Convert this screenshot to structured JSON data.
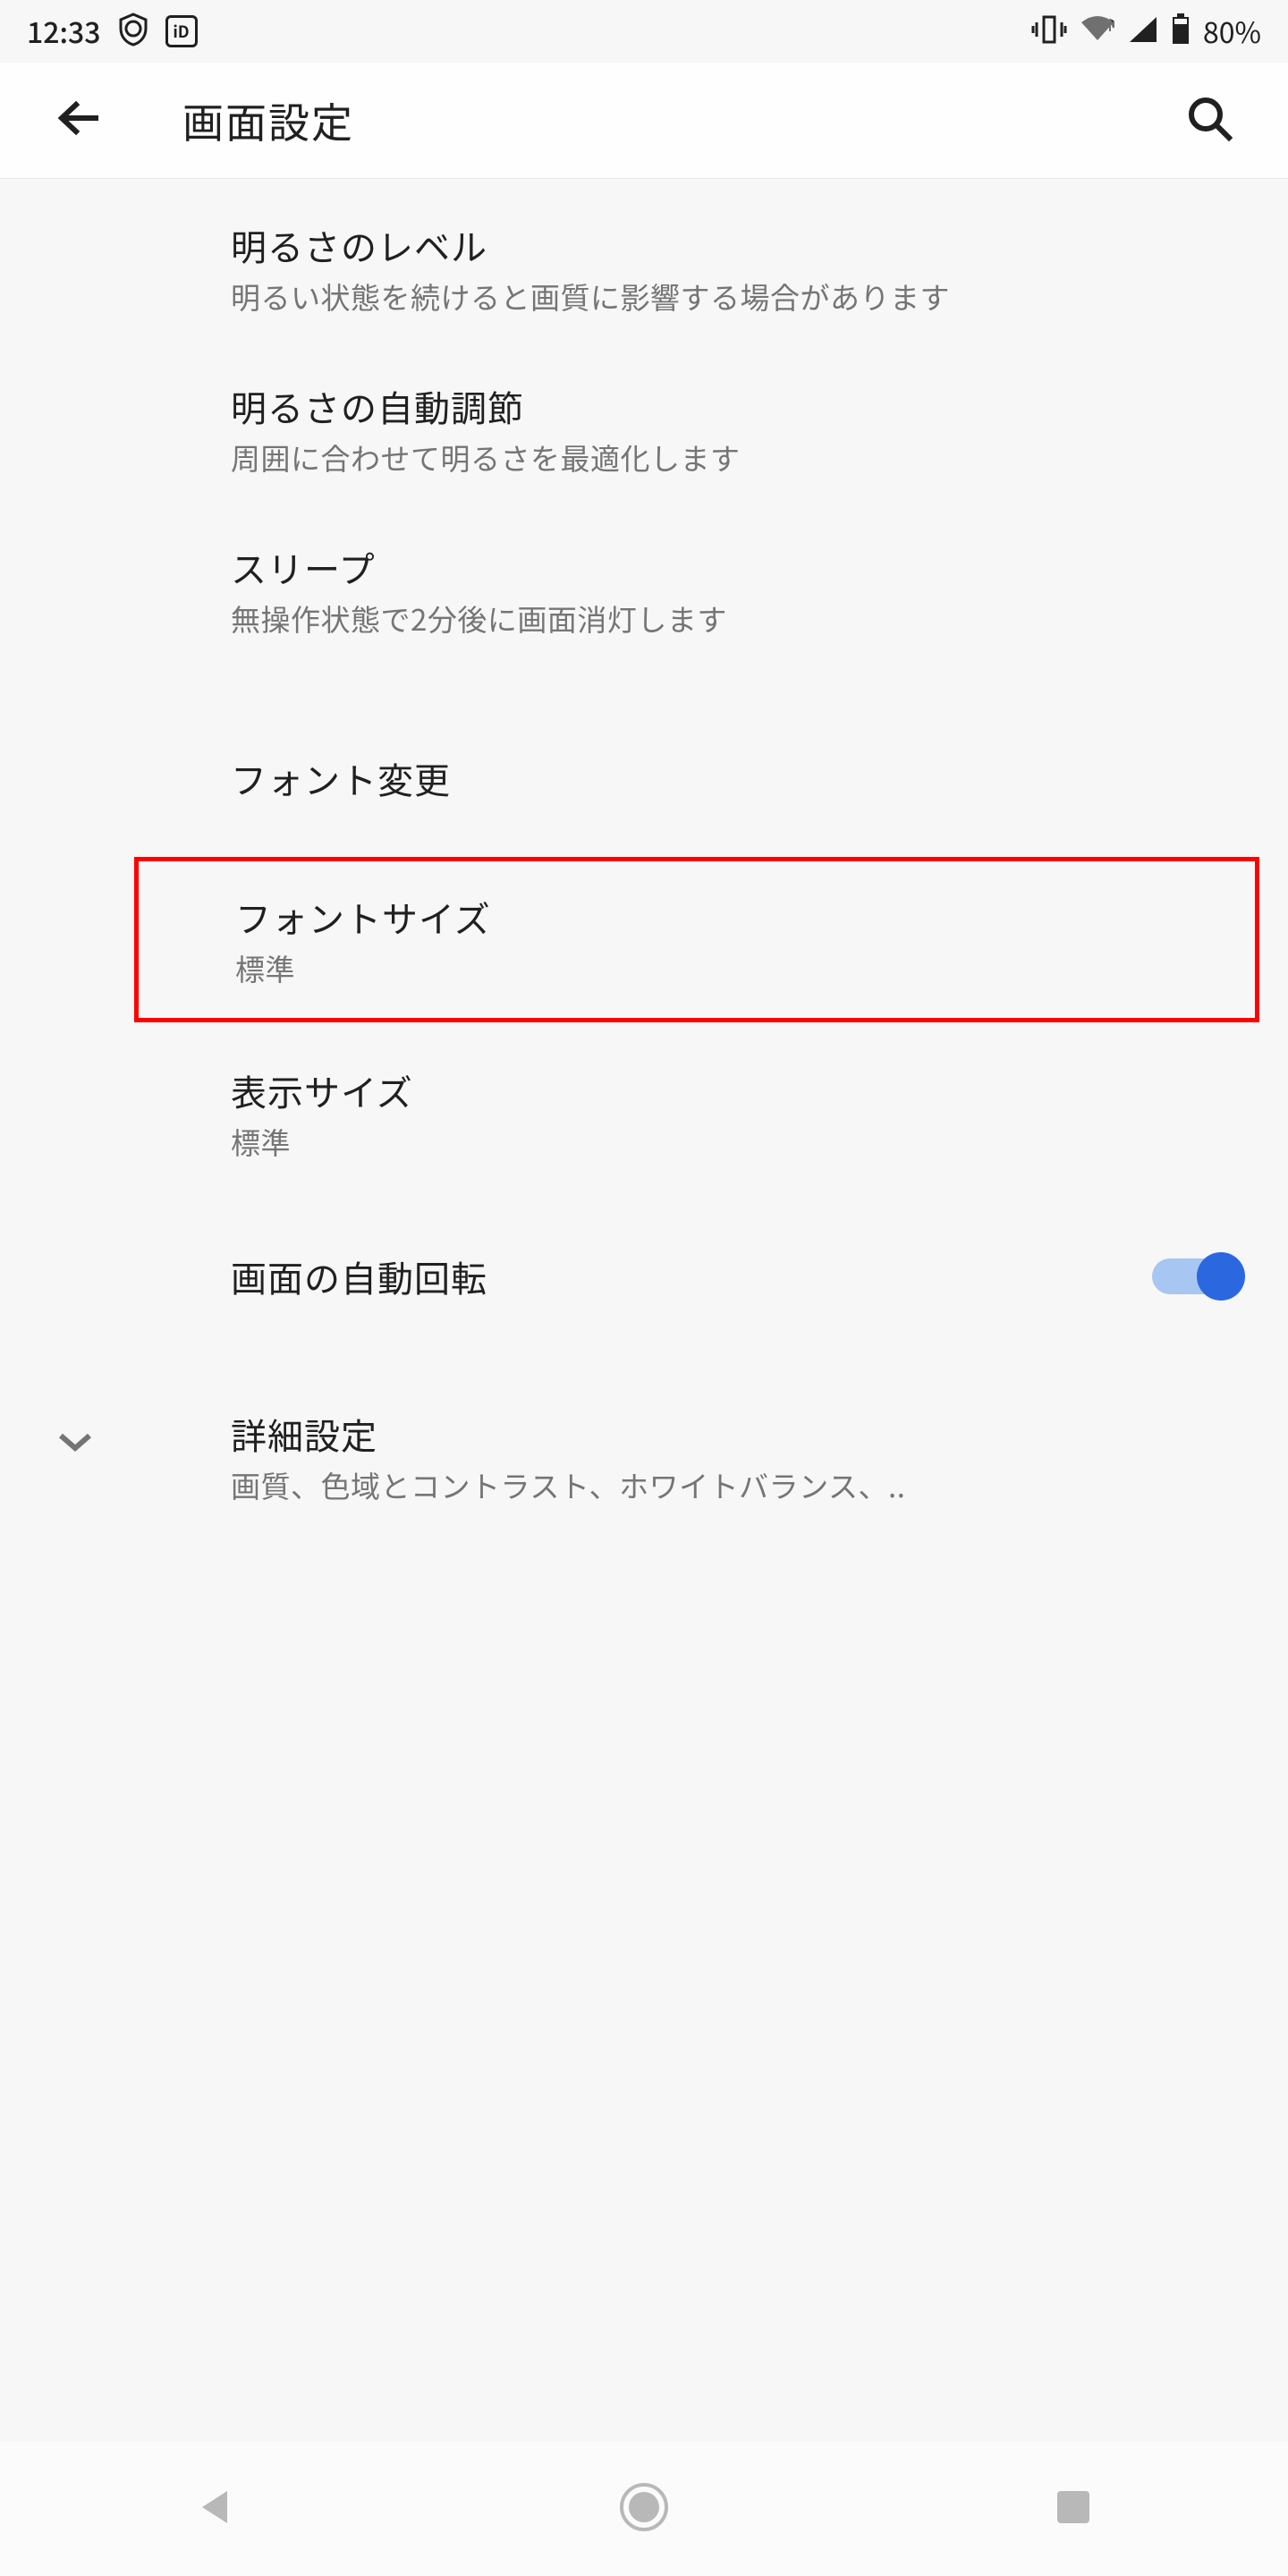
{
  "status": {
    "time": "12:33",
    "battery_pct": "80%"
  },
  "header": {
    "title": "画面設定"
  },
  "settings": {
    "brightness": {
      "title": "明るさのレベル",
      "desc": "明るい状態を続けると画質に影響する場合があります"
    },
    "auto_brightness": {
      "title": "明るさの自動調節",
      "desc": "周囲に合わせて明るさを最適化します"
    },
    "sleep": {
      "title": "スリープ",
      "desc": "無操作状態で2分後に画面消灯します"
    },
    "font_change": {
      "title": "フォント変更"
    },
    "font_size": {
      "title": "フォントサイズ",
      "desc": "標準"
    },
    "display_size": {
      "title": "表示サイズ",
      "desc": "標準"
    },
    "auto_rotate": {
      "title": "画面の自動回転",
      "enabled": true
    },
    "advanced": {
      "title": "詳細設定",
      "desc": "画質、色域とコントラスト、ホワイトバランス、.."
    }
  }
}
